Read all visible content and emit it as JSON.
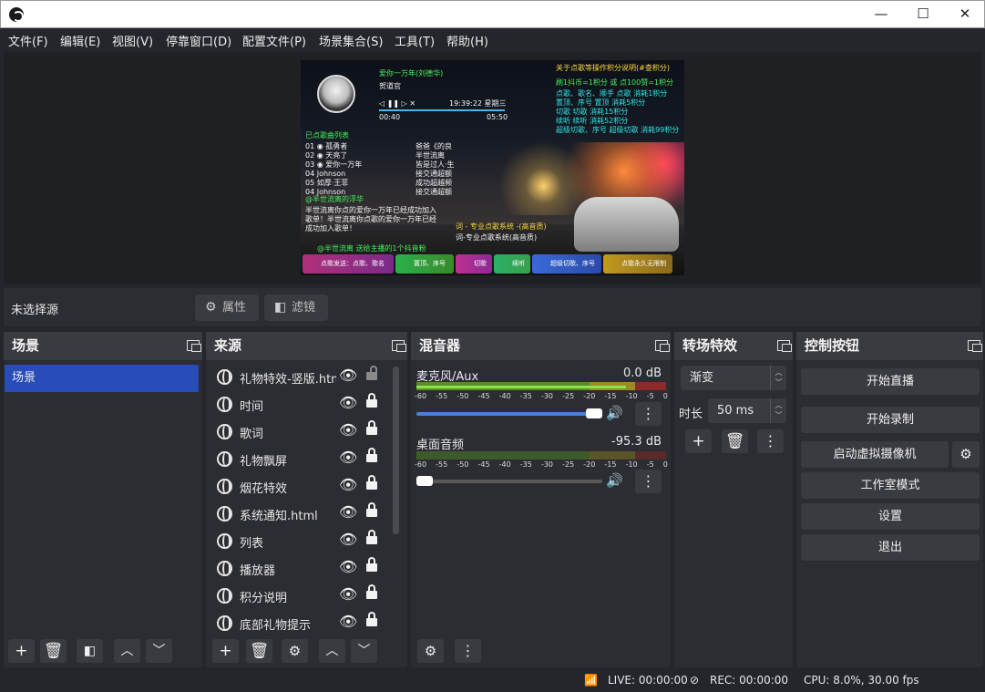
{
  "window": {
    "controls": {
      "minimize": "—",
      "maximize": "☐",
      "close": "✕"
    }
  },
  "menu": [
    "文件(F)",
    "编辑(E)",
    "视图(V)",
    "停靠窗口(D)",
    "配置文件(P)",
    "场景集合(S)",
    "工具(T)",
    "帮助(H)"
  ],
  "preview": {
    "song_title": "爱你一万年(刘德华)",
    "artist": "贺道官",
    "clock": "19:39:22 星期三",
    "elapsed": "00:40",
    "duration": "05:50",
    "playlist_title": "已点歌曲列表",
    "playlist": [
      "01 ◉ 孤勇者",
      "02 ◉ 天亮了",
      "03 ◉ 爱你一万年",
      "04 Johnson",
      "05 如厚·王菲",
      "04 Johnson"
    ],
    "playlist_right": [
      "爸爸《的良",
      "半世流离",
      "皆是过人·生",
      "接交通超额",
      "成功超越频",
      "接交通超额"
    ],
    "points_title": "关于点歌等操作积分说明(#查积分)",
    "points_subtitle": "刷1抖币=1积分 或 点100赞=1积分",
    "points_rows": [
      "点歌、歌名、顺手     点歌      消耗1积分",
      "置顶、序号            置顶      消耗5积分",
      "切歌                  切歌      消耗15积分",
      "续听                  续听      消耗52积分",
      "超级切歌、序号        超级切歌  消耗99积分"
    ],
    "notice_title": "@半世流离的浮华",
    "notice_text": "半世流离你点的爱你一万年已经成功加入歌单！半世流离你点歌的爱你一万年已经成功加入歌单！",
    "ad_title": "词 - 专业点歌系统 -(高音质)",
    "ad_sub": "词-专业点歌系统(高音质)",
    "footer_note": "@半世流离 送给主播的1个抖音粉",
    "bottom_buttons": [
      "点歌发送：点歌、歌名",
      "置顶、序号",
      "切歌",
      "续听",
      "超级切歌、序号",
      "点歌永久无限制"
    ]
  },
  "properties_bar": {
    "no_source": "未选择源",
    "properties_btn": "属性",
    "filters_btn": "滤镜"
  },
  "scenes": {
    "title": "场景",
    "items": [
      "场景"
    ]
  },
  "sources": {
    "title": "来源",
    "items": [
      {
        "name": "礼物特效-竖版.html",
        "locked": false
      },
      {
        "name": "时间",
        "locked": true
      },
      {
        "name": "歌词",
        "locked": true
      },
      {
        "name": "礼物飘屏",
        "locked": true
      },
      {
        "name": "烟花特效",
        "locked": true
      },
      {
        "name": "系统通知.html",
        "locked": true
      },
      {
        "name": "列表",
        "locked": true
      },
      {
        "name": "播放器",
        "locked": true
      },
      {
        "name": "积分说明",
        "locked": true
      },
      {
        "name": "底部礼物提示",
        "locked": true
      }
    ]
  },
  "mixer": {
    "title": "混音器",
    "channels": [
      {
        "name": "麦克风/Aux",
        "db": "0.0 dB",
        "volume": 1.0
      },
      {
        "name": "桌面音频",
        "db": "-95.3 dB",
        "volume": 0.0
      }
    ],
    "scale": [
      "-60",
      "-55",
      "-50",
      "-45",
      "-40",
      "-35",
      "-30",
      "-25",
      "-20",
      "-15",
      "-10",
      "-5",
      "0"
    ]
  },
  "transitions": {
    "title": "转场特效",
    "selected": "渐变",
    "duration_label": "时长",
    "duration_value": "50 ms"
  },
  "controls": {
    "title": "控制按钮",
    "start_stream": "开始直播",
    "start_record": "开始录制",
    "virtual_cam": "启动虚拟摄像机",
    "studio_mode": "工作室模式",
    "settings": "设置",
    "exit": "退出"
  },
  "status": {
    "live": "LIVE: 00:00:00",
    "rec": "REC: 00:00:00",
    "cpu": "CPU: 8.0%, 30.00 fps"
  },
  "colors": {
    "accent": "#284cb8",
    "panel": "#2c2d33",
    "background": "#25262b"
  }
}
